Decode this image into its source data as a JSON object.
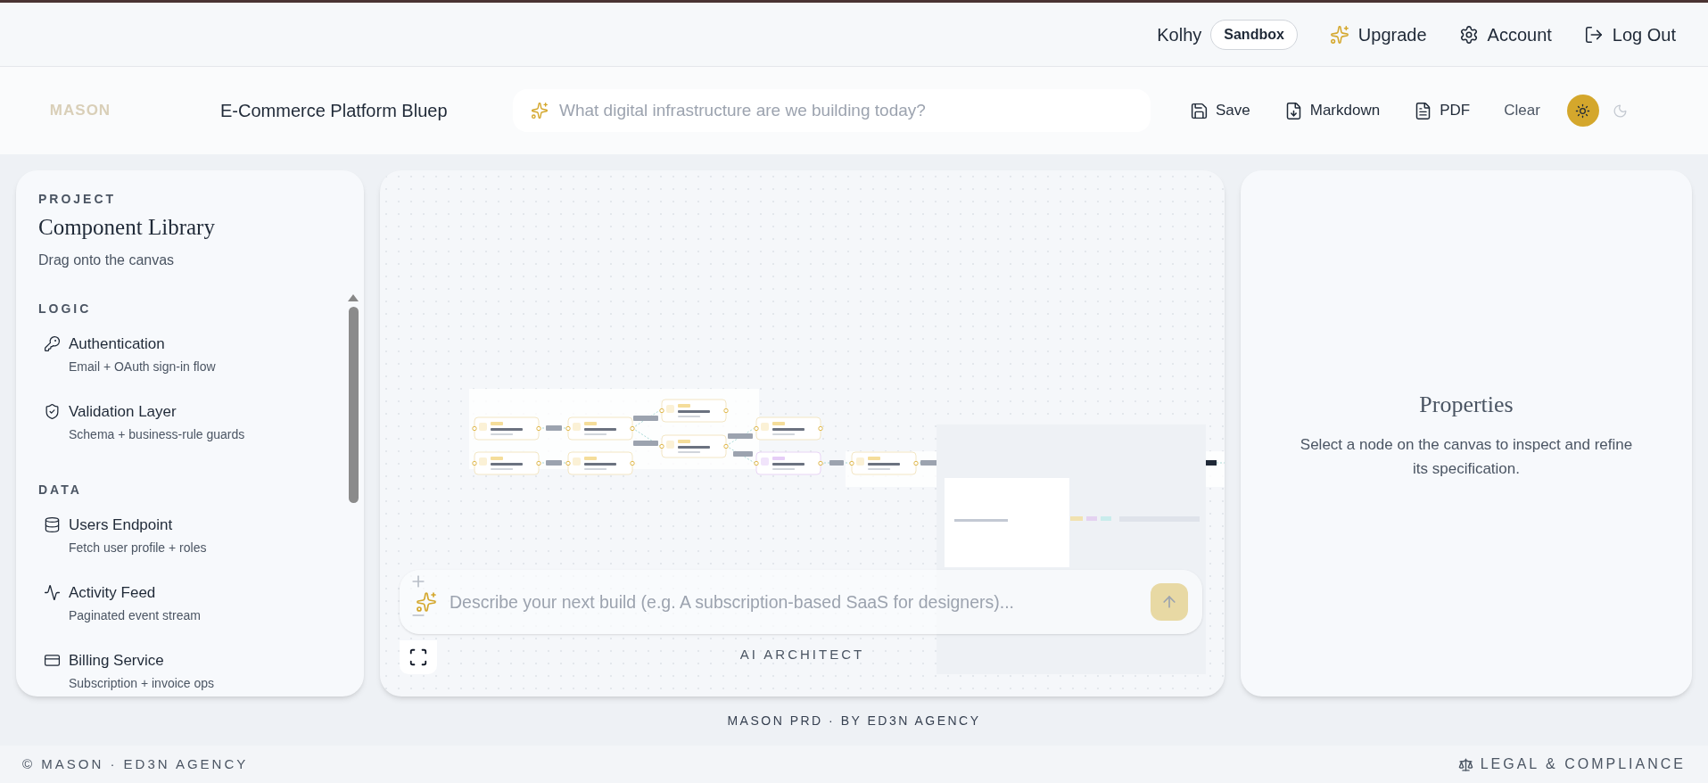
{
  "top_bar": {
    "user": "Kolhy",
    "plan_badge": "Sandbox",
    "links": [
      {
        "label": "Upgrade",
        "kind": "upgrade"
      },
      {
        "label": "Account",
        "kind": "account"
      },
      {
        "label": "Log Out",
        "kind": "logout"
      }
    ]
  },
  "header": {
    "logo": "MASON",
    "project_title": "E-Commerce Platform Bluep",
    "prompt_placeholder": "What digital infrastructure are we building today?",
    "actions": [
      {
        "label": "Save",
        "kind": "save"
      },
      {
        "label": "Markdown",
        "kind": "download"
      },
      {
        "label": "PDF",
        "kind": "file"
      },
      {
        "label": "Clear",
        "kind": "plain"
      }
    ],
    "theme": [
      {
        "kind": "light",
        "selected": true
      },
      {
        "kind": "dark",
        "selected": false
      }
    ]
  },
  "library": {
    "eyebrow": "PROJECT",
    "title": "Component Library",
    "subtitle": "Drag onto the canvas",
    "groups": [
      {
        "label": "LOGIC",
        "items": [
          {
            "name": "Authentication",
            "description": "Email + OAuth sign-in flow",
            "kind": "key"
          },
          {
            "name": "Validation Layer",
            "description": "Schema + business-rule guards",
            "kind": "shield"
          }
        ]
      },
      {
        "label": "DATA",
        "items": [
          {
            "name": "Users Endpoint",
            "description": "Fetch user profile + roles",
            "kind": "database"
          },
          {
            "name": "Activity Feed",
            "description": "Paginated event stream",
            "kind": "activity"
          },
          {
            "name": "Billing Service",
            "description": "Subscription + invoice ops",
            "kind": "card"
          }
        ]
      }
    ]
  },
  "canvas": {
    "prompt_placeholder": "Describe your next build (e.g. A subscription-based SaaS for designers)...",
    "caption": "AI ARCHITECT"
  },
  "properties": {
    "title": "Properties",
    "hint": "Select a node on the canvas to inspect and refine its specification."
  },
  "credit": "MASON PRD · BY ED3N AGENCY",
  "footer": {
    "copyright": "© MASON · ED3N AGENCY",
    "legal": "LEGAL & COMPLIANCE"
  }
}
